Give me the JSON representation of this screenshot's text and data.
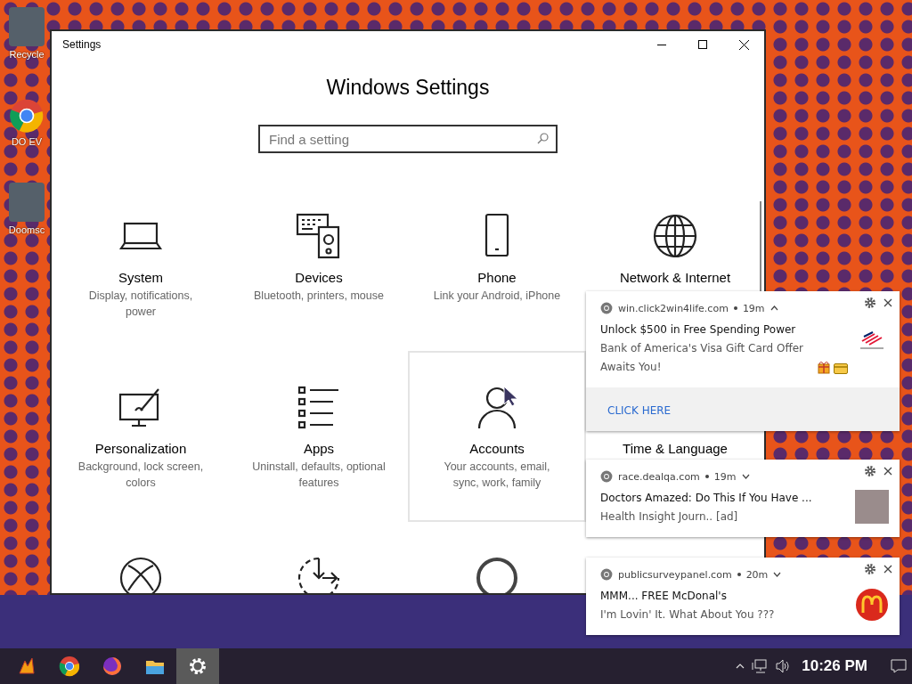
{
  "desktop_icons": [
    {
      "label": "Recycle",
      "kind": "image"
    },
    {
      "label": "DO EV",
      "kind": "browser"
    },
    {
      "label": "Doomsc",
      "kind": "image"
    }
  ],
  "settings_window": {
    "title": "Settings",
    "heading": "Windows Settings",
    "search": {
      "placeholder": "Find a setting"
    },
    "categories": [
      {
        "title": "System",
        "description": "Display, notifications, power",
        "selected": false
      },
      {
        "title": "Devices",
        "description": "Bluetooth, printers, mouse",
        "selected": false
      },
      {
        "title": "Phone",
        "description": "Link your Android, iPhone",
        "selected": false
      },
      {
        "title": "Network & Internet",
        "selected": false
      },
      {
        "title": "Personalization",
        "description": "Background, lock screen, colors",
        "selected": false
      },
      {
        "title": "Apps",
        "description": "Uninstall, defaults, optional features",
        "selected": false
      },
      {
        "title": "Accounts",
        "description": "Your accounts, email, sync, work, family",
        "selected": true
      },
      {
        "title": "Time & Language",
        "selected": false
      },
      {
        "selected": false
      },
      {
        "selected": false
      },
      {
        "selected": false
      }
    ]
  },
  "notifications": [
    {
      "site": "win.click2win4life.com",
      "time": "19m",
      "expanded": true,
      "title": "Unlock $500 in Free Spending Power",
      "message": "Bank of America's Visa Gift Card Offer Awaits You!",
      "kind": "logo",
      "action": "CLICK HERE"
    },
    {
      "site": "race.dealqa.com",
      "time": "19m",
      "expanded": false,
      "title": "Doctors Amazed: Do This If You Have ...",
      "message": "Health Insight Journ.. [ad]",
      "kind": "photo"
    },
    {
      "site": "publicsurveypanel.com",
      "time": "20m",
      "expanded": false,
      "title": "MMM... FREE McDonal's",
      "message": "I'm Lovin' It. What About You  ???",
      "kind": "badge"
    }
  ],
  "taskbar": {
    "apps": [
      {
        "selected": false
      },
      {
        "selected": false
      },
      {
        "selected": false
      },
      {
        "selected": false
      },
      {
        "selected": true
      }
    ],
    "clock": "10:26 PM"
  }
}
